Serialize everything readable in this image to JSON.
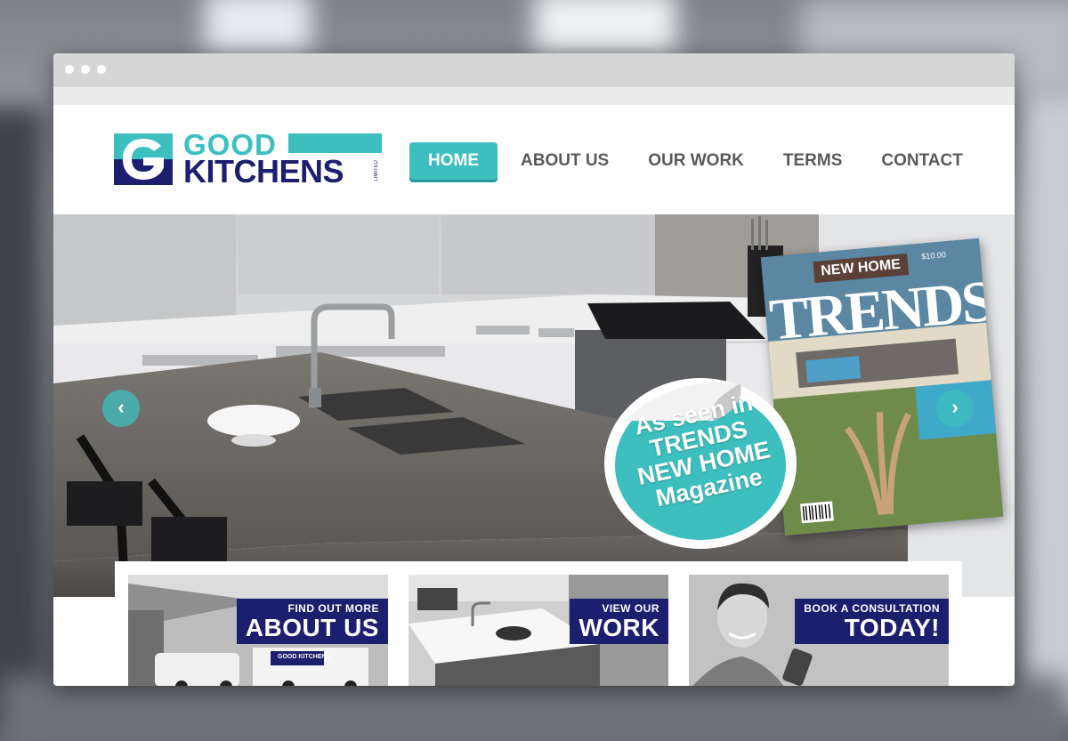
{
  "brand": {
    "name_line1": "GOOD",
    "name_line2": "KITCHENS",
    "suffix": "LIMITED",
    "colors": {
      "teal": "#3dbfbf",
      "navy": "#1c1f6e"
    }
  },
  "nav": {
    "items": [
      {
        "label": "HOME",
        "active": true
      },
      {
        "label": "ABOUT US",
        "active": false
      },
      {
        "label": "OUR WORK",
        "active": false
      },
      {
        "label": "TERMS",
        "active": false
      },
      {
        "label": "CONTACT",
        "active": false
      }
    ]
  },
  "hero": {
    "prev_icon": "chevron-left-icon",
    "next_icon": "chevron-right-icon",
    "badge_lines": [
      "As seen in",
      "TRENDS",
      "NEW HOME",
      "Magazine"
    ],
    "magazine": {
      "banner": "NEW HOME",
      "title": "TRENDS",
      "price": "$10.00"
    }
  },
  "cards": [
    {
      "small": "FIND OUT MORE",
      "big": "ABOUT US",
      "van_text": "GOOD KITCHENS"
    },
    {
      "small": "VIEW OUR",
      "big": "WORK"
    },
    {
      "small": "BOOK A CONSULTATION",
      "big": "TODAY!"
    }
  ]
}
